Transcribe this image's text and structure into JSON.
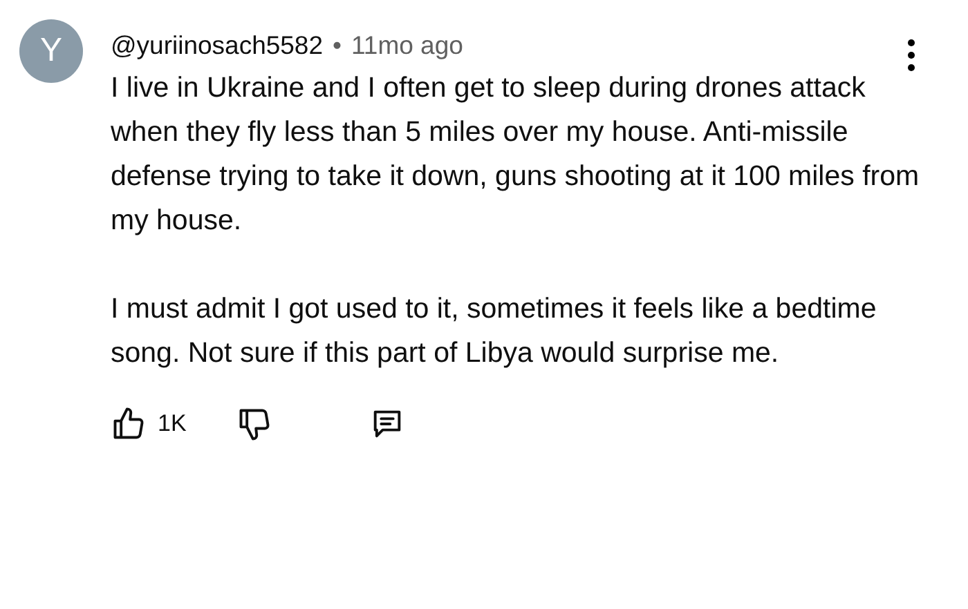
{
  "comment": {
    "avatar_letter": "Y",
    "author": "@yuriinosach5582",
    "separator": "•",
    "time": "11mo ago",
    "paragraphs": [
      "I live in Ukraine and I often get to sleep during drones attack when they fly less than 5 miles over my house. Anti-missile defense trying to take it down, guns shooting at it 100 miles from my house.",
      "I must admit I got used to it, sometimes it feels like a bedtime song. Not sure if this part of Libya would surprise me."
    ],
    "likes": "1K"
  }
}
